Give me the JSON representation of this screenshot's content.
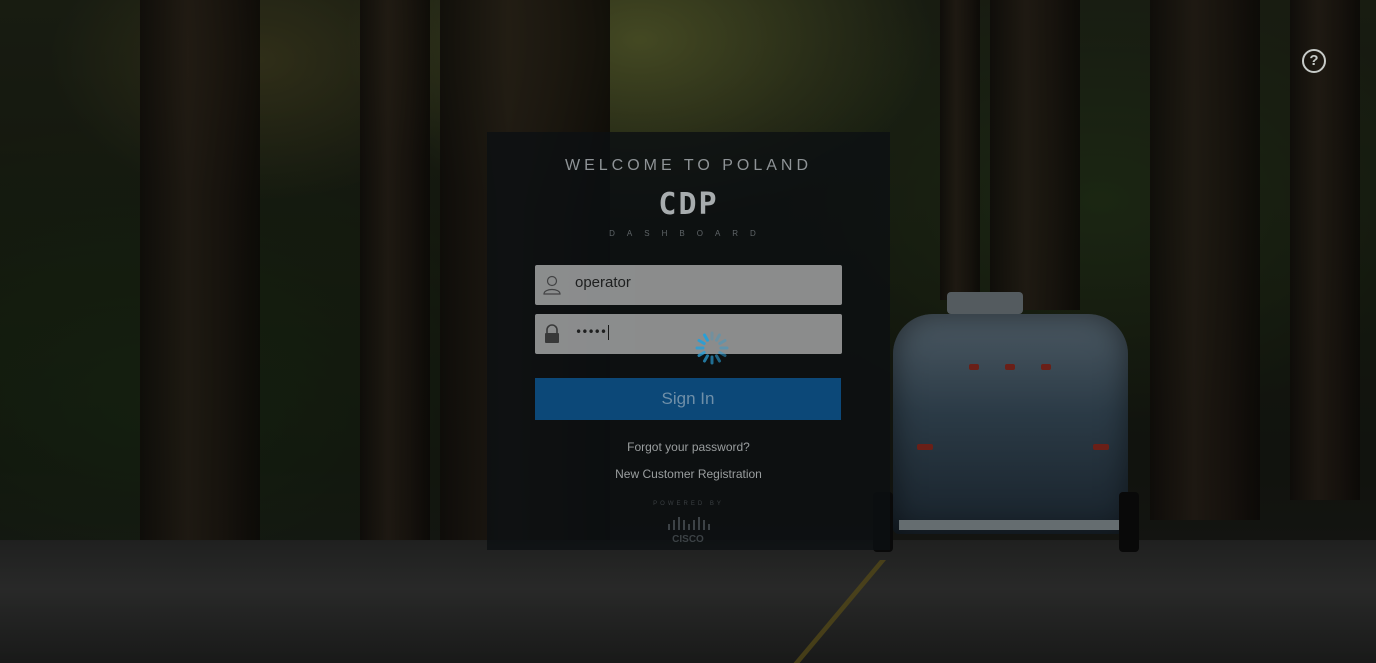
{
  "help": {
    "icon": "help-circle-icon",
    "symbol": "?"
  },
  "login": {
    "welcome": "WELCOME TO POLAND",
    "logo_text": "CDP",
    "logo_subtext": "DASHBOARD",
    "username": {
      "icon": "user-icon",
      "value": "operator"
    },
    "password": {
      "icon": "lock-icon",
      "masked_value": "•••••"
    },
    "spinner_icon": "loading-spinner-icon",
    "sign_in_label": "Sign In",
    "forgot_password": "Forgot your password?",
    "registration": "New Customer Registration",
    "powered_by": "POWERED BY",
    "vendor_logo_text": "CISCO"
  },
  "colors": {
    "sign_in_button": "#0c4878",
    "panel_bg": "#0c1012",
    "spinner": "#2a9fd6"
  }
}
